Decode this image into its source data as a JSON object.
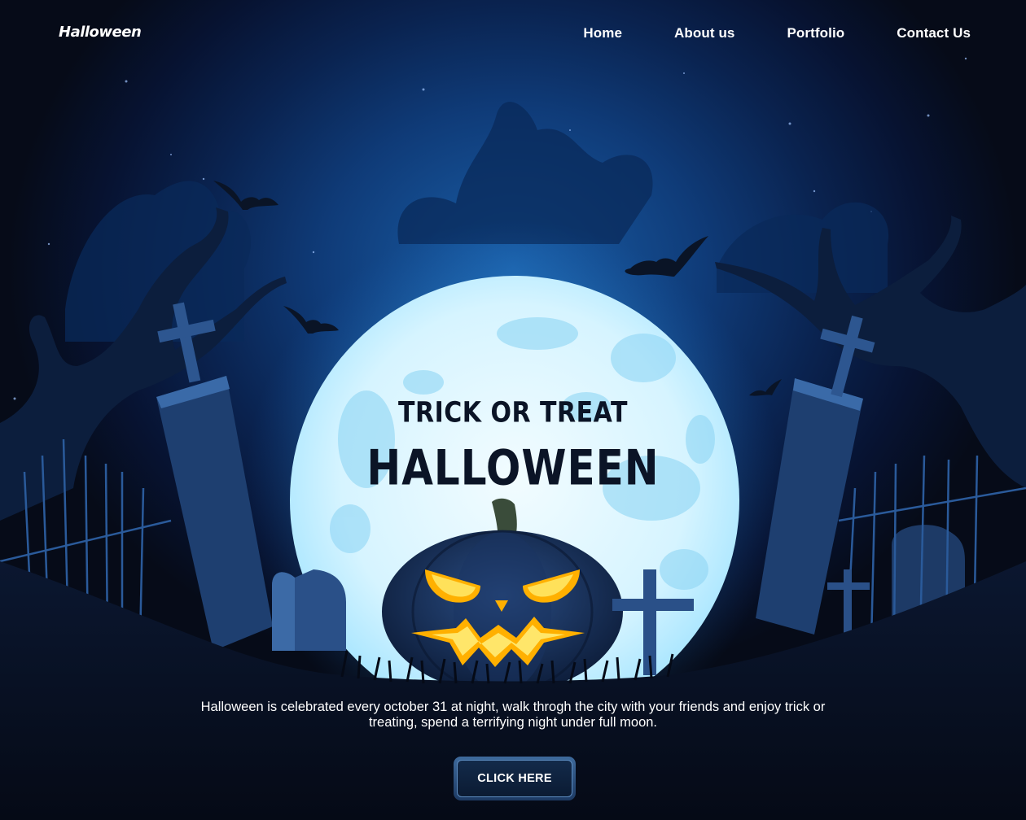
{
  "brand": {
    "logo_text": "Halloween"
  },
  "nav": {
    "items": [
      {
        "label": "Home"
      },
      {
        "label": "About us"
      },
      {
        "label": "Portfolio"
      },
      {
        "label": "Contact Us"
      }
    ]
  },
  "hero": {
    "tagline": "TRICK OR TREAT",
    "title": "HALLOWEEN",
    "description": "Halloween is celebrated every october 31 at night, walk throgh the city with your friends and enjoy trick or treating, spend a terrifying night under full moon.",
    "cta_label": "CLICK HERE"
  },
  "colors": {
    "background": "#060b18",
    "sky": "#0f3b78",
    "moon": "#dff6ff",
    "pumpkin_glow": "#ffb000",
    "title_text": "#0b1426"
  },
  "icons": [
    "bat-icon",
    "moon-illustration",
    "pumpkin-illustration",
    "cross-gravestone-icon",
    "dead-tree-illustration"
  ]
}
